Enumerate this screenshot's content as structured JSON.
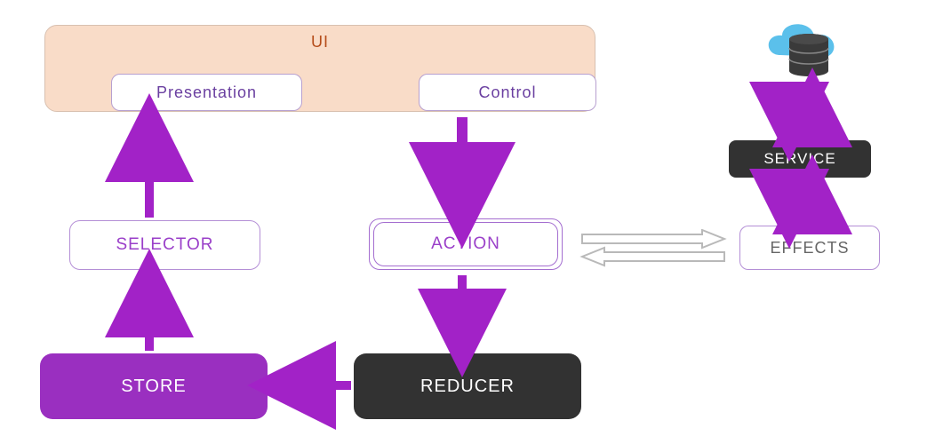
{
  "ui": {
    "title": "UI",
    "presentation": "Presentation",
    "control": "Control"
  },
  "nodes": {
    "selector": "SELECTOR",
    "action": "ACTION",
    "store": "STORE",
    "reducer": "REDUCER",
    "service": "SERVICE",
    "effects": "EFFECTS"
  },
  "colors": {
    "purple": "#9a2fc0",
    "arrow": "#a222c7",
    "dark": "#323232",
    "peach": "#f9dcc8",
    "cloud": "#5bc0eb"
  },
  "flow": [
    "UI.Control → ACTION",
    "ACTION → REDUCER",
    "REDUCER → STORE",
    "STORE → SELECTOR",
    "SELECTOR → UI.Presentation",
    "ACTION ↔ EFFECTS",
    "EFFECTS ↔ SERVICE",
    "SERVICE ↔ Cloud Database"
  ]
}
